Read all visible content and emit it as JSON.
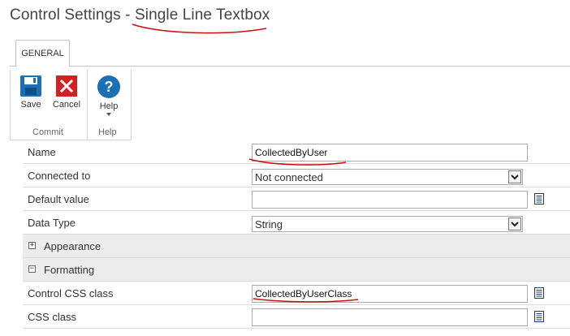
{
  "page": {
    "title_prefix": "Control Settings - ",
    "title_control": "Single Line Textbox"
  },
  "ribbon": {
    "tab_general": "GENERAL",
    "save_label": "Save",
    "cancel_label": "Cancel",
    "help_label": "Help",
    "group_commit": "Commit",
    "group_help": "Help"
  },
  "form": {
    "name_label": "Name",
    "name_value": "CollectedByUser",
    "connected_label": "Connected to",
    "connected_value": "Not connected",
    "default_label": "Default value",
    "default_value": "",
    "datatype_label": "Data Type",
    "datatype_value": "String",
    "appearance_label": "Appearance",
    "formatting_label": "Formatting",
    "control_css_label": "Control CSS class",
    "control_css_value": "CollectedByUserClass",
    "css_label": "CSS class",
    "css_value": ""
  },
  "colors": {
    "accent_blue": "#1b6fb5",
    "cancel_red": "#d42020",
    "annotation_red": "#cc1111"
  }
}
